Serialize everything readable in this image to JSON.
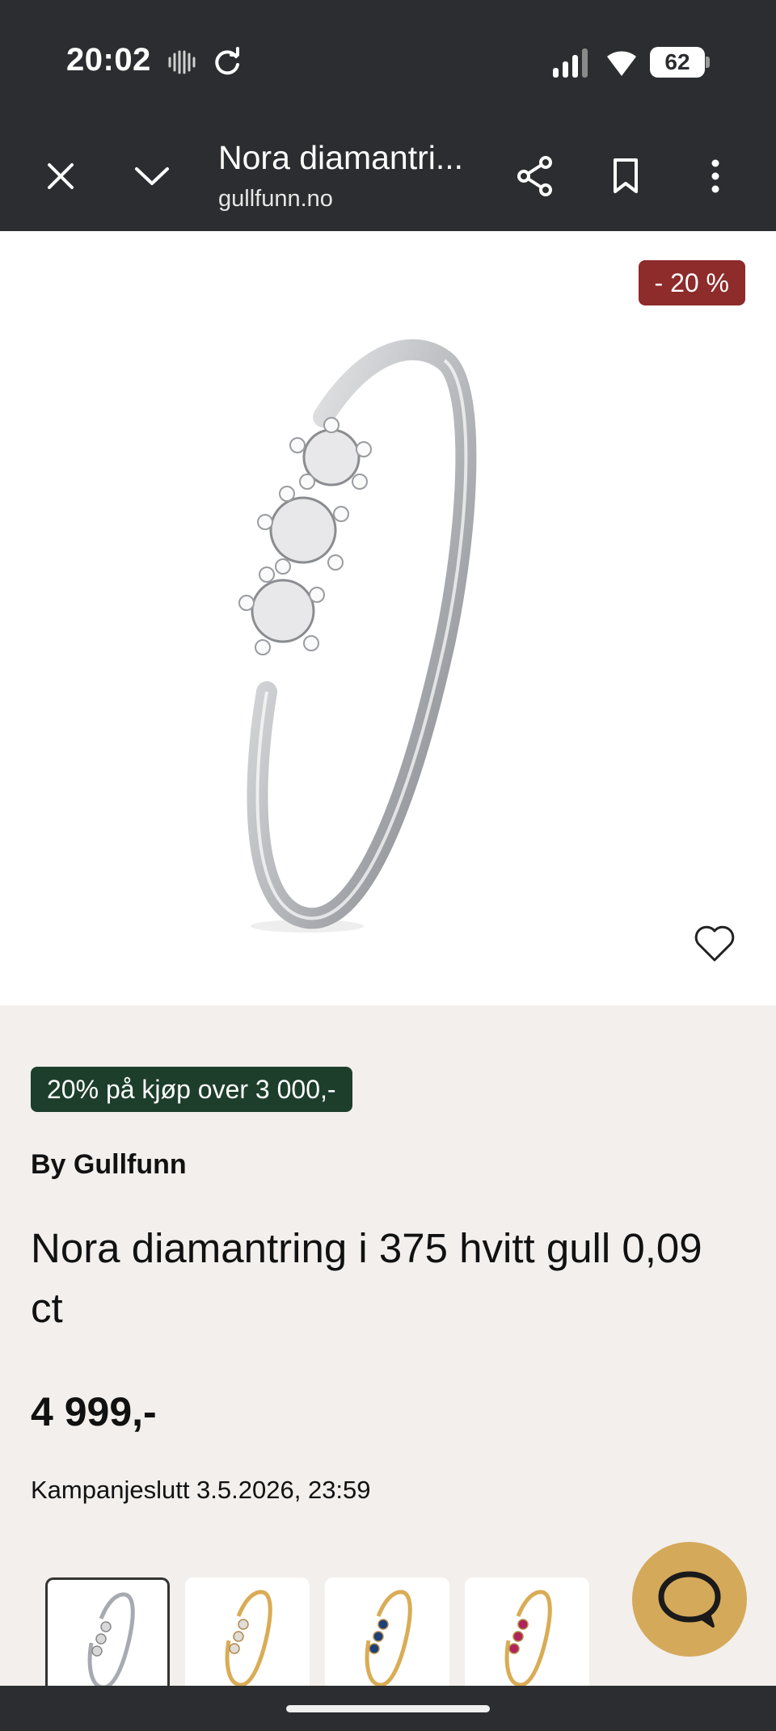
{
  "status_bar": {
    "time": "20:02",
    "battery_level": "62"
  },
  "browser": {
    "page_title": "Nora diamantri...",
    "domain": "gullfunn.no",
    "close_icon": "close-icon",
    "collapse_icon": "chevron-down-icon",
    "share_icon": "share-icon",
    "bookmark_icon": "bookmark-icon",
    "menu_icon": "more-vert-icon"
  },
  "product": {
    "discount_badge": "- 20 %",
    "promo_tag": "20% på kjøp over 3 000,-",
    "brand": "By Gullfunn",
    "title": "Nora diamantring i 375 hvitt gull 0,09 ct",
    "price": "4 999,-",
    "campaign_end": "Kampanjeslutt 3.5.2026, 23:59",
    "favorite_icon": "heart-outline-icon"
  },
  "thumbnails": [
    {
      "variant": "white-gold-diamond",
      "selected": true
    },
    {
      "variant": "yellow-gold-diamond",
      "selected": false
    },
    {
      "variant": "yellow-gold-sapphire",
      "selected": false
    },
    {
      "variant": "yellow-gold-ruby",
      "selected": false
    }
  ],
  "chat": {
    "icon": "chat-bubble-icon"
  },
  "colors": {
    "toolbar_bg": "#2c2d30",
    "page_bg": "#f2efec",
    "discount_badge_bg": "#8e2b2b",
    "promo_tag_bg": "#1e3e2c",
    "chat_button_bg": "#d4a95a"
  }
}
